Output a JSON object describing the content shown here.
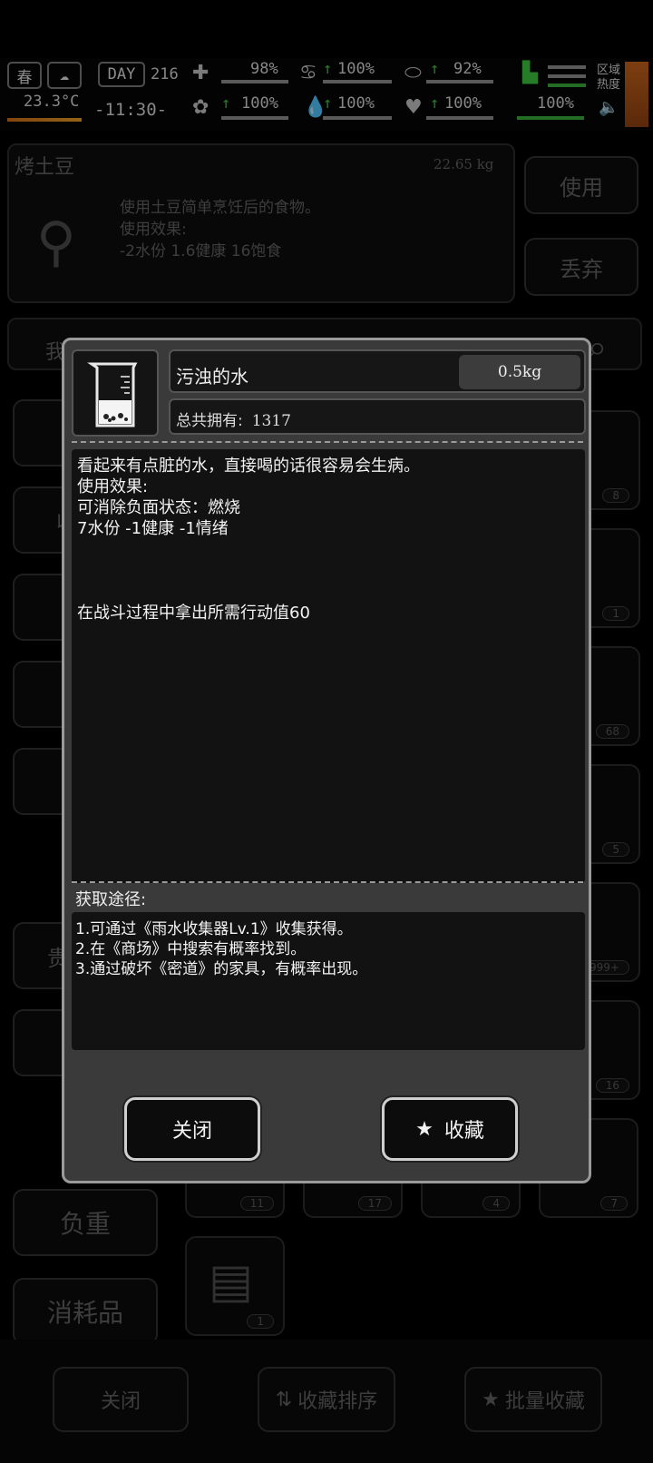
{
  "status": {
    "season": "春",
    "temperature": "23.3°C",
    "day_label": "DAY",
    "day_number": "216",
    "clock": "-11:30-",
    "stats": {
      "health": "98%",
      "stomach": "100%",
      "pill": "92%",
      "mood": "100%",
      "water": "100%",
      "heart": "100%",
      "stamina": "100%"
    },
    "region_label": "区域热度"
  },
  "background": {
    "item_name": "烤土豆",
    "item_weight": "22.65 kg",
    "item_desc_lines": [
      "使用土豆简单烹饪后的食物。",
      "使用效果:",
      "-2水份 1.6健康 16饱食"
    ],
    "use_button": "使用",
    "discard_button": "丢弃",
    "tab_partial_1": "我",
    "tab_partial_2": "收",
    "tab_partial_3": "贵",
    "tab_weight": "负重",
    "tab_consumables": "消耗品",
    "slot_counts": [
      "8",
      "1",
      "68",
      "5",
      "999+",
      "16",
      "11",
      "17",
      "4",
      "7",
      "1"
    ],
    "bottom_close": "关闭",
    "bottom_sort": "收藏排序",
    "bottom_batch": "批量收藏"
  },
  "modal": {
    "item_name": "污浊的水",
    "weight": "0.5kg",
    "owned_label": "总共拥有:",
    "owned_count": "1317",
    "description_lines": [
      "看起来有点脏的水，直接喝的话很容易会生病。",
      "使用效果:",
      "可消除负面状态：燃烧",
      "7水份 -1健康 -1情绪",
      "",
      "",
      "",
      "在战斗过程中拿出所需行动值60"
    ],
    "source_title": "获取途径:",
    "source_lines": [
      "1.可通过《雨水收集器Lv.1》收集获得。",
      "2.在《商场》中搜索有概率找到。",
      "3.通过破坏《密道》的家具，有概率出现。"
    ],
    "close_button": "关闭",
    "favorite_button": "收藏"
  }
}
